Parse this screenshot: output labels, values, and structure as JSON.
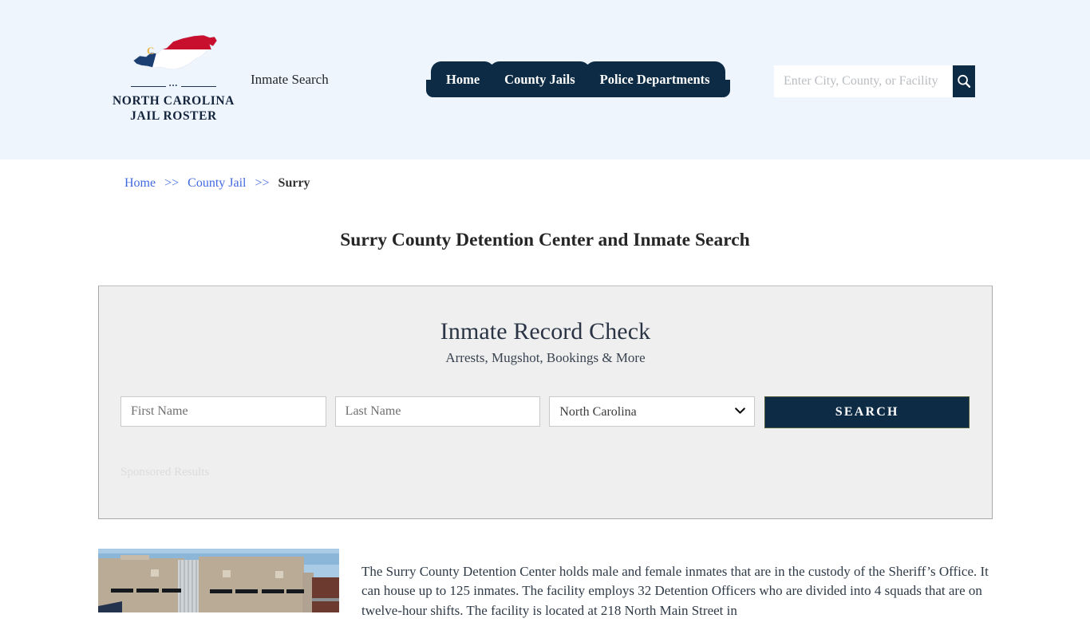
{
  "header": {
    "logo": {
      "line1": "NORTH CAROLINA",
      "line2": "JAIL ROSTER",
      "map_letter": "C",
      "dots": "•••"
    },
    "tagline": "Inmate Search",
    "nav": [
      {
        "label": "Home"
      },
      {
        "label": "County Jails"
      },
      {
        "label": "Police Departments"
      }
    ],
    "search": {
      "placeholder": "Enter City, County, or Facility",
      "value": "",
      "icon": "search-icon"
    },
    "background_color": "#eef5fd"
  },
  "breadcrumb": {
    "items": [
      {
        "label": "Home",
        "link": true
      },
      {
        "label": "County Jail",
        "link": true
      },
      {
        "label": "Surry",
        "link": false
      }
    ],
    "separator": ">>"
  },
  "page_title": "Surry County Detention Center and Inmate Search",
  "panel": {
    "title": "Inmate Record Check",
    "subtitle": "Arrests, Mugshot, Bookings & More",
    "form": {
      "first_name": {
        "placeholder": "First Name",
        "value": ""
      },
      "last_name": {
        "placeholder": "Last Name",
        "value": ""
      },
      "state": {
        "selected": "North Carolina",
        "options": [
          "North Carolina"
        ]
      },
      "search_button": "SEARCH"
    },
    "sponsored_label": "Sponsored Results",
    "background_color": "#efefef"
  },
  "content": {
    "image_alt": "Surry County Detention Center building",
    "paragraph": "The Surry County Detention Center holds male and female inmates that are in the custody of the Sheriff’s Office. It can house up to 125 inmates. The facility employs 32 Detention Officers who are divided into 4 squads that are on twelve-hour shifts. The facility is located at 218 North Main Street in"
  },
  "colors": {
    "navy": "#0d2b45",
    "link_blue": "#4169e1",
    "header_bg": "#eef5fd",
    "panel_bg": "#efefef"
  }
}
